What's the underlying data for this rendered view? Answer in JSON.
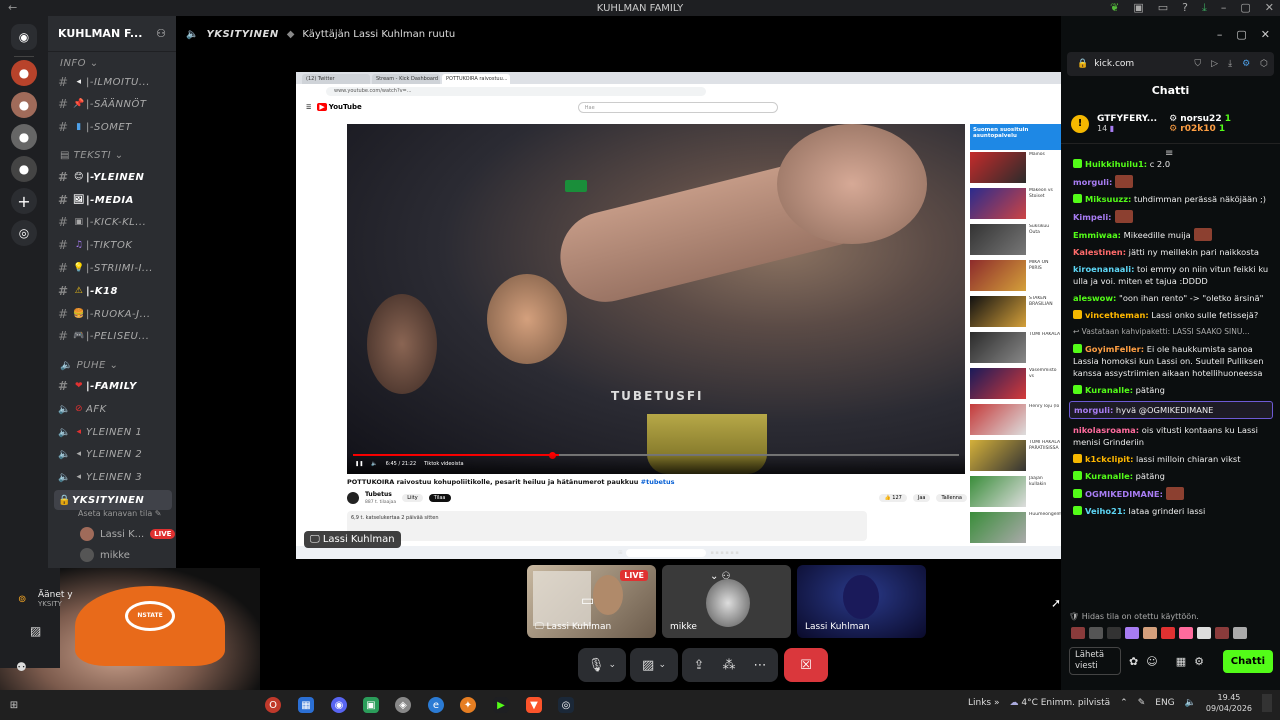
{
  "titlebar": {
    "title": "KUHLMAN FAMILY",
    "icons": [
      "back-arrow-icon",
      "leaf-icon",
      "inbox-icon",
      "window-icon",
      "help-icon",
      "download-icon",
      "minimize-icon",
      "maximize-icon",
      "close-icon"
    ]
  },
  "server": {
    "name": "KUHLMAN F...",
    "categories": {
      "info": "INFO",
      "teksti": "TEKSTI",
      "puhe": "PUHE"
    },
    "info_channels": [
      "|-ILMOITU...",
      "|-SÄÄNNÖT",
      "|-SOMET"
    ],
    "text_channels": [
      "|-YLEINEN",
      "|-MEDIA",
      "|-KICK-KL...",
      "|-TIKTOK",
      "|-STRIIMI-I...",
      "|-K18",
      "|-RUOKA-J...",
      "|-PELISEU..."
    ],
    "voice_channels": [
      "|-FAMILY",
      "AFK",
      "YLEINEN 1",
      "YLEINEN 2",
      "YLEINEN 3",
      "YKSITYINEN"
    ],
    "channel_status": "Aseta kanavan tila",
    "members": [
      {
        "name": "Lassi K...",
        "badge": "LIVE"
      },
      {
        "name": "mikke",
        "badge": ""
      }
    ],
    "voice_status": {
      "title": "Äänet y",
      "sub": "YKSITY"
    }
  },
  "topbar": {
    "channel": "YKSITYINEN",
    "stream_title": "Käyttäjän Lassi Kuhlman ruutu"
  },
  "stream": {
    "tabs": [
      "(12) Twitter",
      "Stream - Kick Dashboard",
      "POTTUKOIRA raivostuu..."
    ],
    "url": "www.youtube.com/watch?v=...",
    "search_placeholder": "Hae",
    "logo": "YouTube",
    "watermark": "TUBETUSFI",
    "time": "6:45 / 21:22",
    "chapter": "Tiktok videoista",
    "video_title": "POTTUKOIRA raivostuu kohupoliitikolle, pesarit heiluu ja hätänumerot paukkuu",
    "hashtag": "#tubetus",
    "channel_name": "Tubetus",
    "subs": "887 t. tilaajaa",
    "join": "Liity",
    "subscribe": "Tilaa",
    "likes": "127",
    "share": "Jaa",
    "save": "Tallenna",
    "desc": "6,9 t. katselukertaa  2 päivää sitten",
    "related_ad": "Suomen suosituin asuntopalvelu",
    "related": [
      "Mainos",
      "Makeon vs Stoiset",
      "Suksikuu Outa",
      "MIKÄ ON PIIRIS",
      "STAKEN BRASILIAN",
      "TOMI HAKALA",
      "Vasemmisto vs",
      "Henry loju (lo",
      "TOMI HAKALA PARATIISISSA",
      "Jaajan kullakin",
      "Huumeongelmat",
      "ESRPMAN?",
      "KUSALLINEN"
    ]
  },
  "stream_badge": "Lassi Kuhlman",
  "participants": [
    {
      "name": "Lassi Kuhlman",
      "badge": "LIVE"
    },
    {
      "name": "mikke",
      "badge": ""
    },
    {
      "name": "Lassi Kuhlman",
      "badge": ""
    }
  ],
  "controls": [
    "microphone-icon",
    "chevron-down-icon",
    "camera-off-icon",
    "chevron-down-icon",
    "screen-share-icon",
    "activities-icon",
    "more-icon",
    "leave-call-icon"
  ],
  "selfcam": {
    "cap_text": "NSTATE"
  },
  "browser": {
    "url": "kick.com",
    "chat_title": "Chatti",
    "pinned": {
      "user": "GTFYFERY...",
      "count": "14",
      "top": [
        {
          "name": "norsu22",
          "n": "1"
        },
        {
          "name": "r02k10",
          "n": "1"
        }
      ]
    },
    "messages": [
      {
        "user": "Huikkihuilu1:",
        "text": " c 2.0",
        "color": "#53fc18",
        "badge": "#53fc18"
      },
      {
        "user": "morguli:",
        "text": "",
        "color": "#a77cf2",
        "emote": true
      },
      {
        "user": "Miksuuzz:",
        "text": " tuhdimman perässä näköjään ;)",
        "color": "#53fc18",
        "badge": "#53fc18"
      },
      {
        "user": "Kimpeli:",
        "text": "",
        "color": "#a77cf2",
        "emote": true
      },
      {
        "user": "Emmiwaa:",
        "text": " Mikeedille muija",
        "color": "#53fc18",
        "emote2": true
      },
      {
        "user": "Kalestinen:",
        "text": " jätti ny meillekin pari naikkosta",
        "color": "#ff6b6b"
      },
      {
        "user": "kiroenanaali:",
        "text": " toi emmy on niin vitun feikki ku ulla ja voi. miten et tajua :DDDD",
        "color": "#5dd6f5"
      },
      {
        "user": "aleswow:",
        "text": " \"oon ihan rento\" -> \"oletko ärsinä\"",
        "color": "#53fc18"
      },
      {
        "user": "vincetheman:",
        "text": " Lassi onko sulle fetissejä?",
        "color": "#ffb800",
        "badge": "#f5b800"
      },
      {
        "user": "",
        "text": "↩ Vastataan kahvipaketti: LASSI SAAKO SINU...",
        "reply": true
      },
      {
        "user": "GoyimFeller:",
        "text": " Ei ole haukkumista sanoa Lassia homoksi kun Lassi on. Suutell Pulliksen kanssa assystriimien aikaan hotellihuoneessa",
        "color": "#ff9f43",
        "badge": "#53fc18"
      },
      {
        "user": "Kuranalle:",
        "text": " pätäng",
        "color": "#53fc18",
        "badge": "#53fc18"
      },
      {
        "user": "morguli:",
        "text": " hyvä @OGMIKEDIMANE",
        "color": "#a77cf2",
        "hl": true
      },
      {
        "user": "nikolasroama:",
        "text": " ois vitusti kontaans ku Lassi menisi Grinderiin",
        "color": "#ff6b9d"
      },
      {
        "user": "k1ckclipit:",
        "text": " lassi milloin chiaran vikst",
        "color": "#ffb800",
        "badge": "#f5b800"
      },
      {
        "user": "Kuranalle:",
        "text": " pätäng",
        "color": "#53fc18",
        "badge": "#53fc18"
      },
      {
        "user": "OGMIKEDIMANE:",
        "text": "",
        "color": "#a77cf2",
        "badge": "#53fc18",
        "emote": true
      },
      {
        "user": "Veiho21:",
        "text": " lataa grinderi lassi",
        "color": "#5dd6f5",
        "badge": "#53fc18"
      }
    ],
    "slowmode": "Hidas tila on otettu käyttöön.",
    "input_placeholder": "Lähetä viesti",
    "send": "Chatti"
  },
  "taskbar": {
    "links": "Links",
    "weather": "4°C  Enimm. pilvistä",
    "lang": "ENG",
    "time": "19.45",
    "date": "09/04/2026"
  }
}
